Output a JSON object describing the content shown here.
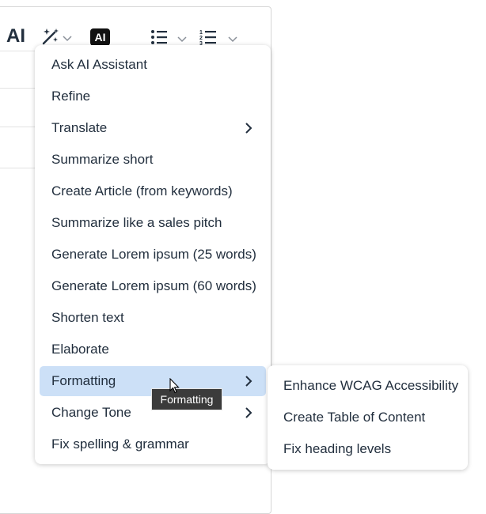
{
  "toolbar": {
    "ai_text": "AI",
    "ai_badge": "AI",
    "buttons": [
      {
        "name": "ai-text-button",
        "icon": "ai-text-icon"
      },
      {
        "name": "magic-wand-button",
        "icon": "magic-wand-icon",
        "has_dropdown": true
      },
      {
        "name": "ai-badge-button",
        "icon": "ai-badge-icon"
      },
      {
        "name": "bullet-list-button",
        "icon": "bullet-list-icon",
        "has_dropdown": true
      },
      {
        "name": "numbered-list-button",
        "icon": "numbered-list-icon",
        "has_dropdown": true
      }
    ]
  },
  "menu": {
    "items": [
      {
        "label": "Ask AI Assistant",
        "submenu": false
      },
      {
        "label": "Refine",
        "submenu": false
      },
      {
        "label": "Translate",
        "submenu": true
      },
      {
        "label": "Summarize short",
        "submenu": false
      },
      {
        "label": "Create Article (from keywords)",
        "submenu": false
      },
      {
        "label": "Summarize like a sales pitch",
        "submenu": false
      },
      {
        "label": "Generate Lorem ipsum (25 words)",
        "submenu": false
      },
      {
        "label": "Generate Lorem ipsum (60 words)",
        "submenu": false
      },
      {
        "label": "Shorten text",
        "submenu": false
      },
      {
        "label": "Elaborate",
        "submenu": false
      },
      {
        "label": "Formatting",
        "submenu": true,
        "active": true
      },
      {
        "label": "Change Tone",
        "submenu": true
      },
      {
        "label": "Fix spelling & grammar",
        "submenu": false
      }
    ]
  },
  "submenu": {
    "parent": "Formatting",
    "items": [
      {
        "label": "Enhance WCAG Accessibility"
      },
      {
        "label": "Create Table of Content"
      },
      {
        "label": "Fix heading levels"
      }
    ]
  },
  "tooltip": {
    "text": "Formatting"
  },
  "colors": {
    "active_item_bg": "#cce0f7",
    "text": "#222f3e",
    "tooltip_bg": "#3b3b3b"
  }
}
